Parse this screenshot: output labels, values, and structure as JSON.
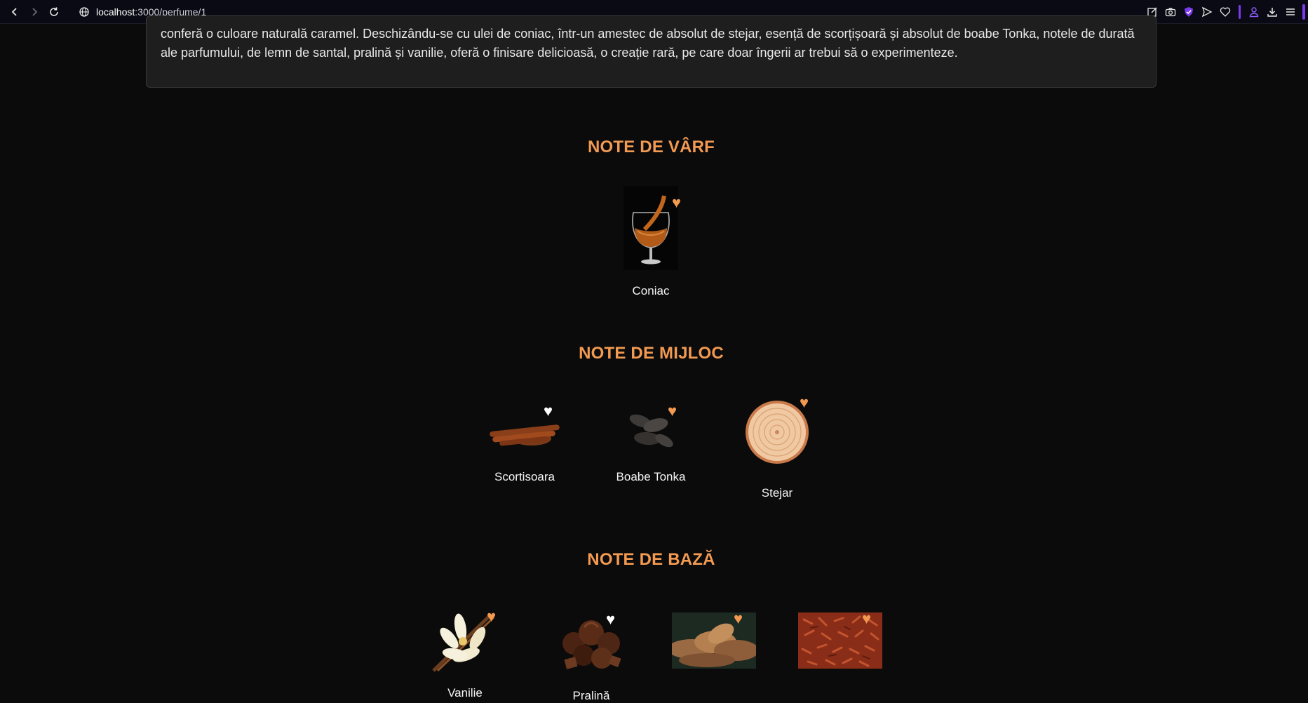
{
  "browser": {
    "url_host": "localhost",
    "url_path": ":3000/perfume/1"
  },
  "description": {
    "text_line1": "conferă o culoare naturală caramel. Deschizându-se cu ulei de coniac, într-un amestec de absolut de stejar, esență de scorțișoară și absolut de boabe Tonka, notele de durată",
    "text_line2": "ale parfumului, de lemn de santal, pralină și vanilie, oferă o finisare delicioasă, o creație rară, pe care doar îngerii ar trebui să o experimenteze."
  },
  "sections": {
    "top": {
      "title": "NOTE DE VÂRF",
      "notes": [
        {
          "name": "Coniac",
          "favorited": true
        }
      ]
    },
    "middle": {
      "title": "NOTE DE MIJLOC",
      "notes": [
        {
          "name": "Scortisoara",
          "favorited": false
        },
        {
          "name": "Boabe Tonka",
          "favorited": true
        },
        {
          "name": "Stejar",
          "favorited": true
        }
      ]
    },
    "base": {
      "title": "NOTE DE BAZĂ",
      "notes": [
        {
          "name": "Vanilie",
          "favorited": true
        },
        {
          "name": "Pralină",
          "favorited": false
        },
        {
          "name": "",
          "favorited": true
        },
        {
          "name": "",
          "favorited": true
        }
      ]
    }
  },
  "colors": {
    "accent": "#f39a52",
    "background": "#0b0b0b",
    "card": "#1e1e1e",
    "heart_inactive": "#ffffff"
  }
}
